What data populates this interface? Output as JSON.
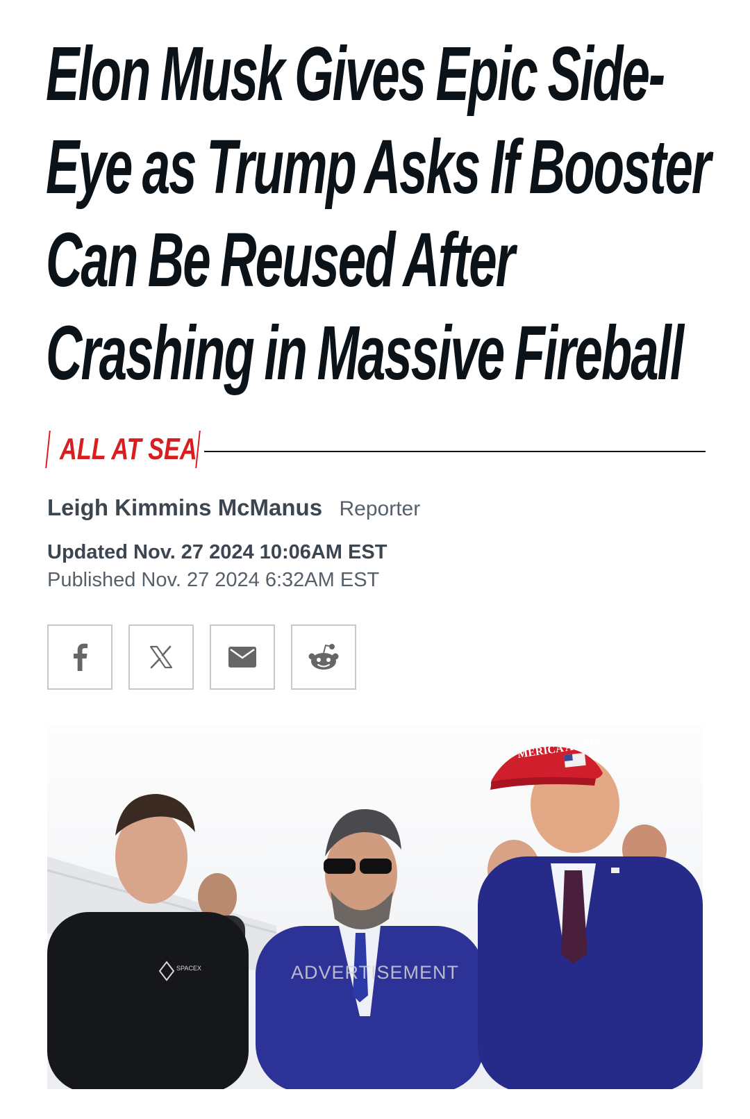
{
  "headline": {
    "lines": [
      "Elon Musk Gives Epic Side-",
      "Eye as Trump Asks If Booster",
      "Can Be Reused After",
      "Crashing in Massive Fireball"
    ]
  },
  "rubric": {
    "label": "ALL AT SEA"
  },
  "byline": {
    "author": "Leigh Kimmins McManus",
    "role": "Reporter"
  },
  "dates": {
    "updated": "Updated Nov. 27 2024 10:06AM EST",
    "published": "Published Nov. 27 2024 6:32AM EST"
  },
  "share": {
    "icons": [
      "facebook-icon",
      "x-icon",
      "mail-icon",
      "reddit-icon"
    ]
  },
  "photo": {
    "overlay_label": "ADVERTISEMENT",
    "cap_text": "MERICA AGAIN",
    "shirt_text": "SPACEX"
  },
  "colors": {
    "headline": "#0b1218",
    "accent_red": "#d81e1e",
    "byline": "#3c4650",
    "suit_blue": "#2a2e8c"
  }
}
